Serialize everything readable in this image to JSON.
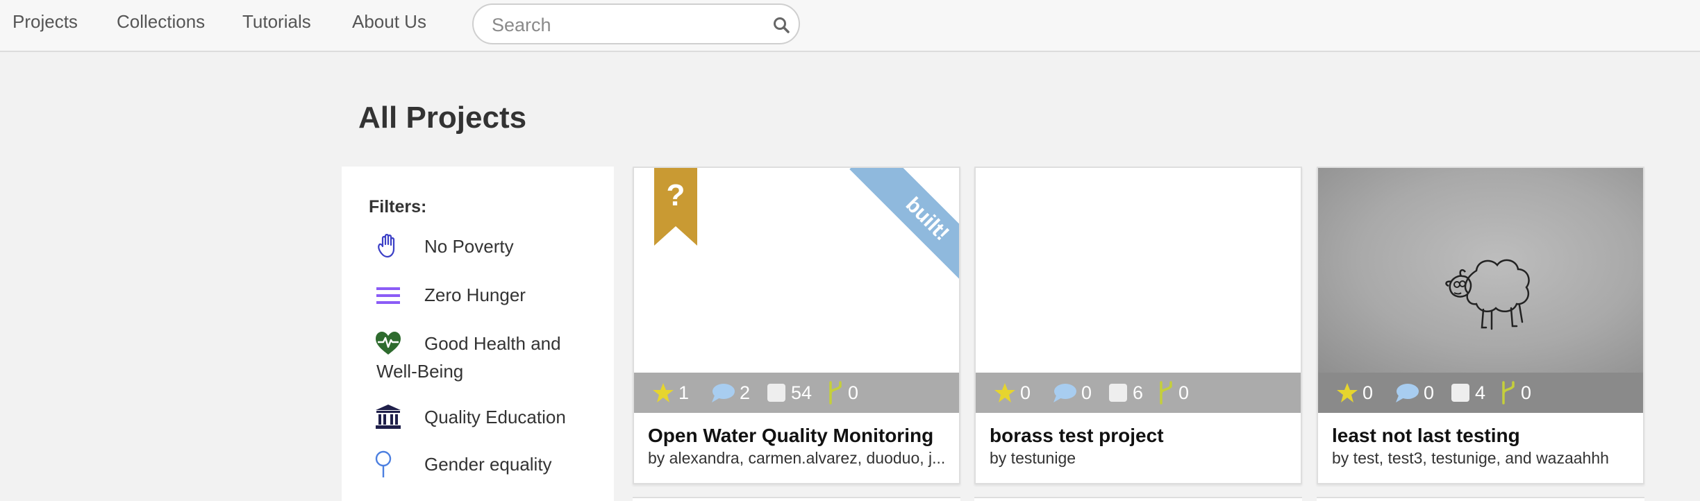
{
  "nav": {
    "links": [
      "Projects",
      "Collections",
      "Tutorials",
      "About Us"
    ],
    "search_placeholder": "Search"
  },
  "page": {
    "title": "All Projects"
  },
  "filters": {
    "title": "Filters:",
    "items": [
      {
        "label": "No Poverty",
        "icon": "hand-icon",
        "color": "#3b3fc6"
      },
      {
        "label": "Zero Hunger",
        "icon": "menu-lines-icon",
        "color": "#8b5cf6"
      },
      {
        "label": "Good Health and Well-Being",
        "icon": "heart-pulse-icon",
        "color": "#2e6b2e"
      },
      {
        "label": "Quality Education",
        "icon": "institution-icon",
        "color": "#1f1f4a"
      },
      {
        "label": "Gender equality",
        "icon": "gender-pin-icon",
        "color": "#4c7fe0"
      }
    ]
  },
  "projects": [
    {
      "title": "Open Water Quality Monitoring",
      "authors": "by alexandra, carmen.alvarez, duoduo, j...",
      "stars": "1",
      "comments": "2",
      "items": "54",
      "forks": "0",
      "badge_text": "?",
      "badge_color": "#c99a33",
      "banner": "built!",
      "banner_color": "#8fb9dd"
    },
    {
      "title": "borass test project",
      "authors": "by testunige",
      "stars": "0",
      "comments": "0",
      "items": "6",
      "forks": "0"
    },
    {
      "title": "least not last testing",
      "authors": "by test, test3, testunige, and wazaahhh",
      "stars": "0",
      "comments": "0",
      "items": "4",
      "forks": "0",
      "image": "sheep-drawing"
    }
  ],
  "colors": {
    "star": "#e6d52e",
    "comment": "#a8cdf0",
    "fork": "#c5cf3b"
  }
}
